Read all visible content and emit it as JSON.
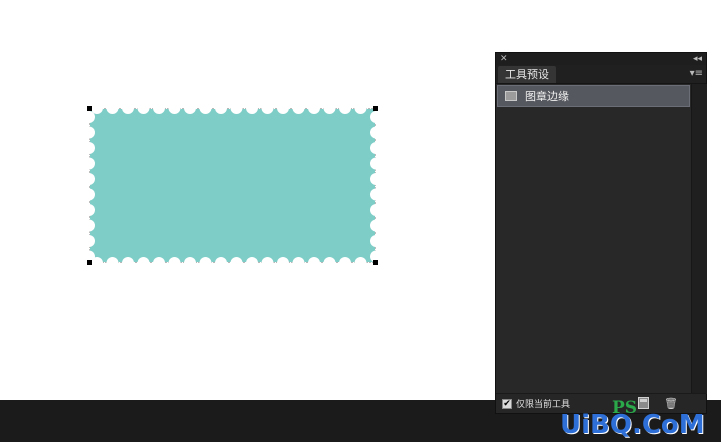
{
  "canvas": {
    "stamp_fill_color": "#7ecdc7",
    "scallop_color": "#ffffff"
  },
  "panel": {
    "close_glyph": "✕",
    "collapse_glyph": "◂◂",
    "tab_label": "工具预设",
    "menu_glyph": "▾≡",
    "items": [
      {
        "label": "图章边缘",
        "selected": true,
        "icon": "preset-swatch-icon"
      }
    ],
    "footer": {
      "checkbox_checked": true,
      "checkbox_glyph": "✔",
      "checkbox_label": "仅限当前工具",
      "new_icon": "new-preset-icon",
      "delete_icon": "trash-icon",
      "delete_glyph": "🗑"
    }
  },
  "watermark": {
    "text": "UiBQ.CoM",
    "ps_text": "PS"
  },
  "colors": {
    "panel_bg": "#282828",
    "selection_bg": "#56585f",
    "bottom_bar": "#1b1b1b",
    "watermark_blue": "#2d6fd6",
    "watermark_green": "#2aa84a"
  }
}
